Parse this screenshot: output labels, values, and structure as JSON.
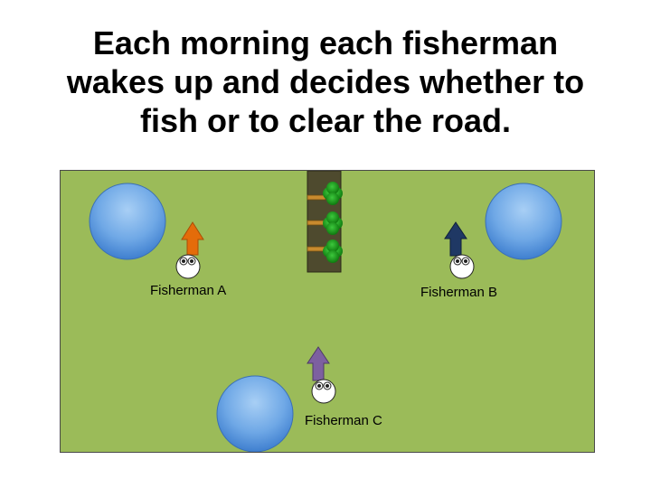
{
  "slide": {
    "title_lines": [
      "Each morning each fisherman",
      "wakes up and decides whether to",
      "fish or to clear the road."
    ]
  },
  "fishermen": [
    {
      "label": "Fisherman A",
      "arrow_color": "#e46c0a"
    },
    {
      "label": "Fisherman B",
      "arrow_color": "#1f3864"
    },
    {
      "label": "Fisherman C",
      "arrow_color": "#7d60a0"
    }
  ],
  "colors": {
    "field": "#9bbb59",
    "pond": "#5b9bd5",
    "road": "#4e4a2e",
    "tree": "#22a022"
  }
}
